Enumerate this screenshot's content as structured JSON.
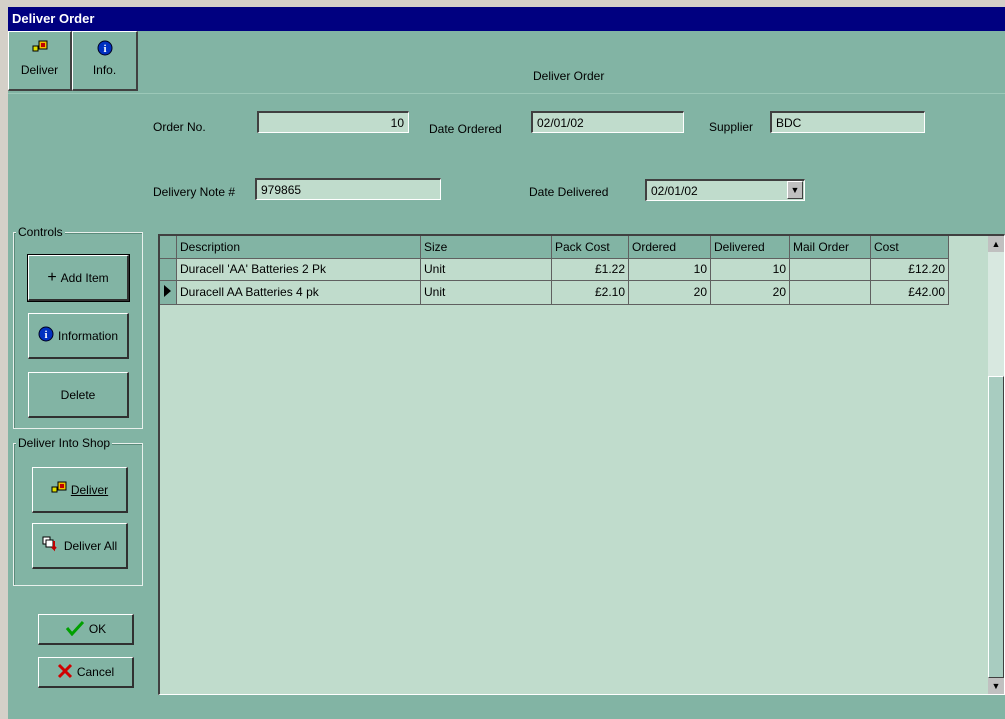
{
  "window": {
    "title": "Deliver Order"
  },
  "toolbar": {
    "deliver_label": "Deliver",
    "info_label": "Info.",
    "caption": "Deliver Order"
  },
  "form": {
    "order_no_label": "Order No.",
    "order_no_value": "10",
    "date_ordered_label": "Date Ordered",
    "date_ordered_value": "02/01/02",
    "supplier_label": "Supplier",
    "supplier_value": "BDC",
    "delivery_note_label": "Delivery Note #",
    "delivery_note_value": "979865",
    "date_delivered_label": "Date Delivered",
    "date_delivered_value": "02/01/02"
  },
  "controls": {
    "group_title": "Controls",
    "add_item_label": "Add Item",
    "information_label": "Information",
    "delete_label": "Delete"
  },
  "deliver_into_shop": {
    "group_title": "Deliver Into Shop",
    "deliver_label": "Deliver",
    "deliver_all_label": "Deliver All"
  },
  "footer": {
    "ok_label": "OK",
    "cancel_label": "Cancel"
  },
  "grid": {
    "columns": [
      "Description",
      "Size",
      "Pack Cost",
      "Ordered",
      "Delivered",
      "Mail Order",
      "Cost"
    ],
    "rows": [
      [
        "Duracell 'AA' Batteries 2 Pk",
        "Unit",
        "£1.22",
        "10",
        "10",
        "",
        "£12.20"
      ],
      [
        "Duracell AA Batteries 4 pk",
        "Unit",
        "£2.10",
        "20",
        "20",
        "",
        "£42.00"
      ]
    ],
    "current_row_index": 1
  },
  "colors": {
    "title_bar": "#000080",
    "form_bg": "#82b4a4",
    "field_bg": "#c0dccc"
  }
}
